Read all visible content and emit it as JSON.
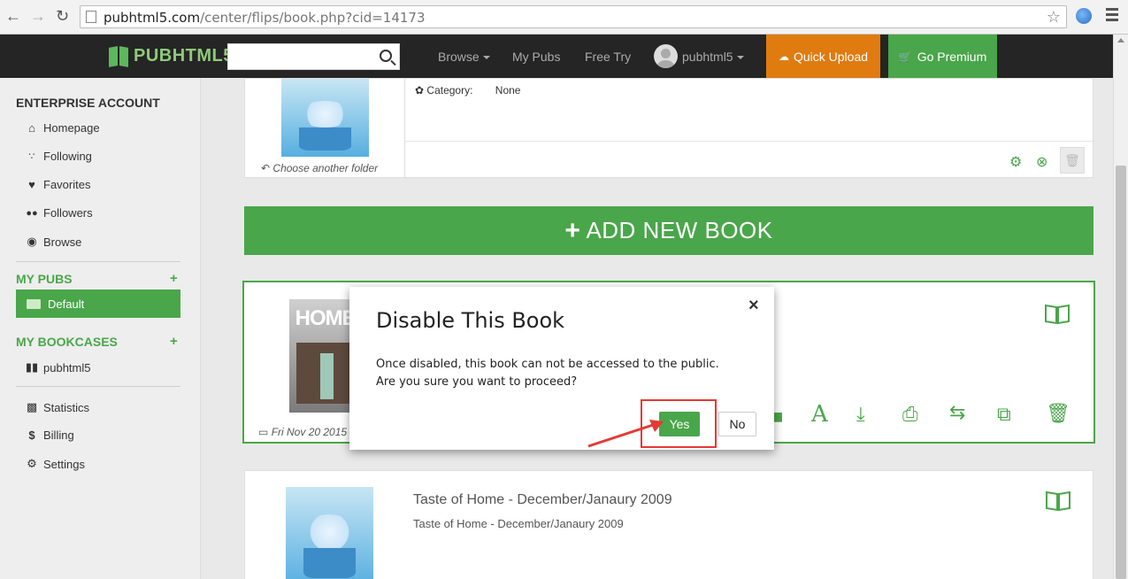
{
  "browser": {
    "url_host": "pubhtml5.com",
    "url_path": "/center/flips/book.php?cid=14173"
  },
  "header": {
    "logo": "PUBHTML5",
    "nav": [
      "Browse",
      "My Pubs",
      "Free Try"
    ],
    "user": "pubhtml5",
    "quick_upload": "Quick Upload",
    "go_premium": "Go Premium",
    "colors": {
      "upload": "#e07b10",
      "premium": "#4aa64a",
      "bar": "#252525"
    }
  },
  "sidebar": {
    "account_title": "ENTERPRISE ACCOUNT",
    "items": [
      {
        "label": "Homepage",
        "icon": "home-icon"
      },
      {
        "label": "Following",
        "icon": "rss-icon"
      },
      {
        "label": "Favorites",
        "icon": "heart-icon"
      },
      {
        "label": "Followers",
        "icon": "users-icon"
      },
      {
        "label": "Browse",
        "icon": "eye-icon"
      }
    ],
    "my_pubs_title": "MY PUBS",
    "my_pubs_active": "Default",
    "my_bookcases_title": "MY BOOKCASES",
    "bookcase_item": "pubhtml5",
    "bottom_items": [
      {
        "label": "Statistics",
        "icon": "bar-chart-icon"
      },
      {
        "label": "Billing",
        "icon": "dollar-icon"
      },
      {
        "label": "Settings",
        "icon": "gear-icon"
      }
    ]
  },
  "main": {
    "folder_card": {
      "category_label": "Category:",
      "category_value": "None",
      "choose_folder": "Choose another folder"
    },
    "add_new_book": "ADD NEW BOOK",
    "book1": {
      "date": "Fri Nov 20 2015"
    },
    "book2": {
      "title": "Taste of Home - December/Janaury 2009",
      "subtitle": "Taste of Home - December/Janaury 2009"
    }
  },
  "modal": {
    "title": "Disable This Book",
    "close": "×",
    "line1": "Once disabled, this book can not be accessed to the public.",
    "line2": "Are you sure you want to proceed?",
    "yes": "Yes",
    "no": "No"
  }
}
